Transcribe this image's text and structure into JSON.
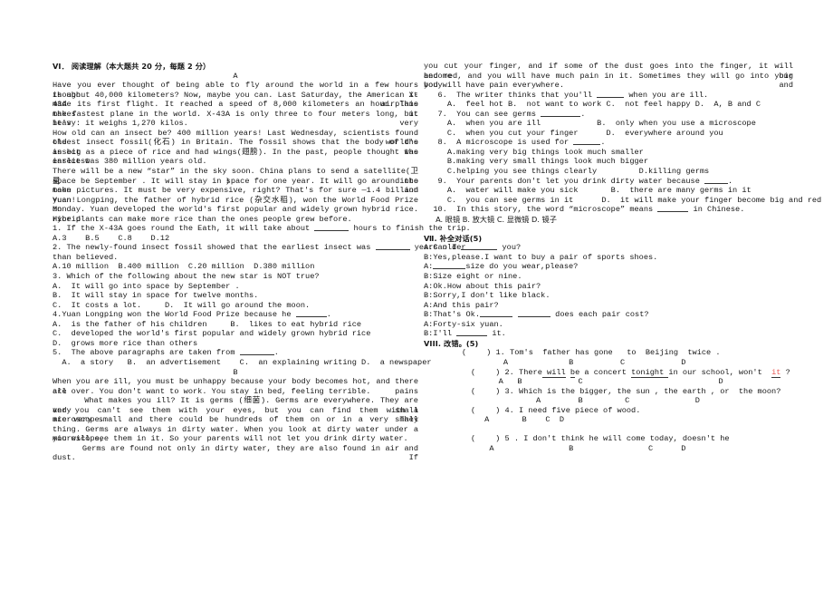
{
  "document": {
    "type": "english-exam-paper",
    "accent_color": "#e8534f",
    "text_color": "#151515"
  },
  "left_column": {
    "section_vi": {
      "heading": "VI． 阅读理解（本大题共 20 分，每题 2 分）",
      "passage_a_label": "A",
      "passage_a": [
        "Have you ever thought of being able to fly around the world in a few hours though it",
        "is about 40,000 kilometers? Now, maybe you can. Last Saturday, the American X-43A airplane",
        "made its first flight. It reached a speed of 8,000 kilometers an hour. This makes it",
        "the fastest plane in the world. X-43A is only three to four meters long, but it's very",
        "heavy: it weighs 1,270 kilos.",
        "How old can an insect be? 400 million years! Last Wednesday, scientists found the world's",
        "oldest insect fossil(化石) in Britain. The fossil shows that the body of the insect was",
        "as big as a piece of rice and had wings(翅膀). In the past, people thought the earliest",
        "insect was 380 million years old.",
        "There will be a new “star” in the sky soon. China plans to send a satellite(卫星) into",
        "space be September . It will stay in space for one year. It will go around the moon and",
        "take pictures. It must be very expensive, right? That's for sure —1.4 billion yuan!",
        "Yuan Longping, the father of hybrid rice (杂交水稻), won the World Food Prize on",
        "Monday. Yuan developed the world's first popular and widely grown hybrid rice. Hybrid",
        "rice plants can make more rice than the ones people grew before."
      ],
      "questions_a": [
        {
          "stem_pre": "1. If the X-43A goes round the Eath, it will take about ",
          "stem_post": " hours to finish the trip.",
          "options_line": "A.3    B.5    C.8    D.12"
        },
        {
          "stem_pre": "2. The newly-found insect fossil showed that the earliest insect was ",
          "stem_post": " years older",
          "stem_cont": "than believed.",
          "options_line": "A.10 million  B.400 million  C.20 million  D.380 million"
        },
        {
          "stem": "3. Which of the following about the new star is NOT true?",
          "option_lines": [
            "A.  It will go into space by September .",
            "B.  It will stay in space for twelve months.",
            "C.  It costs a lot.     D.  It will go around the moon."
          ]
        },
        {
          "stem_pre": "4.Yuan Longping won the World Food Prize because he ",
          "stem_post": ".",
          "option_lines": [
            "A.  is the father of his children     B.  likes to eat hybrid rice",
            "C.  developed the world's first popular and widely grown hybrid rice",
            "D.  grows more rice than others"
          ]
        },
        {
          "stem_pre": "5.  The above paragraphs are taken from ",
          "stem_post": ".",
          "options_line": "  A.  a story   B.  an advertisement    C.  an explaining writing D.  a newspaper"
        }
      ],
      "passage_b_label": "B",
      "passage_b": [
        "When you are ill, you must be unhappy because your body becomes hot, and there are pains",
        "all over. You don't want to work. You stay in bed, feeling terrible.",
        "      What makes you ill? It is germs (细菌). Germs are everywhere. They are very small",
        "and you can't see them with your eyes, but you can find them with a microscope. They",
        "are very small and there could be hundreds of them on or in a very small thing.",
        "      Germs are always in dirty water. When you look at dirty water under a microscope,",
        "you will see them in it. So your parents will not let you drink dirty water.",
        "      Germs are found not only in dirty water, they are also found in air and dust. If"
      ]
    }
  },
  "right_column": {
    "passage_b_continued": [
      "you cut your finger, and if some of the dust goes into the finger, it will become big",
      "and red, and you will have much pain in it. Sometimes they will go into your body and",
      "you will have pain everywhere."
    ],
    "questions_b": [
      {
        "stem_pre": "   6.  The writer thinks that you'll ",
        "stem_post": " when you are ill.",
        "option_lines": [
          "     A.  feel hot B.  not want to work C.  not feel happy D.  A, B and C"
        ]
      },
      {
        "stem_pre": "   7.  You can see germs ",
        "stem_post": ".",
        "option_lines": [
          "     A.  when you are ill            B.  only when you use a microscope",
          "     C.  when you cut your finger      D.  everywhere around you"
        ]
      },
      {
        "stem_pre": "   8.  A microscope is used for ",
        "stem_post": ".",
        "option_lines": [
          "     A.making very big things look much smaller",
          "     B.making very small things look much bigger",
          "     C.helping you see things clearly         D.killing germs"
        ]
      },
      {
        "stem_pre": "   9.  Your parents don't let you drink dirty water because ",
        "stem_post": ".",
        "option_lines": [
          "     A.  water will make you sick       B.  there are many germs in it",
          "     C.  you can see germs in it      D.  it will make your finger become big and red"
        ]
      },
      {
        "stem_pre": "  10.  In this story, the word “microscope” means ",
        "stem_post": " in Chinese.",
        "option_lines": [
          "     A. 眼镜 B. 放大镜 C. 显微镜 D. 镜子"
        ]
      }
    ],
    "section_vii": {
      "heading": "Ⅶ. 补全对话(5)",
      "dialogue": [
        {
          "pre": "A:Can I ",
          "post": " you?"
        },
        {
          "pre": "B:Yes,please.I want to buy a pair of sports shoes.",
          "post": ""
        },
        {
          "pre": "A:",
          "post": "size do you wear,please?"
        },
        {
          "pre": "B:Size eight or nine.",
          "post": ""
        },
        {
          "pre": "A:Ok.How about this pair?",
          "post": ""
        },
        {
          "pre": "B:Sorry,I don't like black.",
          "post": ""
        },
        {
          "pre": "A:And this pair?",
          "post": ""
        },
        {
          "pre": "B:That's Ok.",
          "post": " does each pair cost?"
        },
        {
          "pre": "A:Forty-six yuan.",
          "post": ""
        },
        {
          "pre": "B:I'll ",
          "post": " it."
        }
      ]
    },
    "section_viii": {
      "heading": "VIII. 改错。(5)",
      "items": [
        {
          "number": "1.",
          "text": "Tom's  father has gone   to  Beijing  twice .",
          "markers": "                 A             B          C            D"
        },
        {
          "number": "2.",
          "text": "There will be a concert tonight in our school, won't  it ?",
          "markers": "                A   B            C                             D",
          "red_word": "it"
        },
        {
          "number": "3.",
          "text": "Which is the bigger, the sun , the earth , or  the moon?",
          "markers": "                        A        B         C              D"
        },
        {
          "number": "4.",
          "text": "I need five piece of wood.",
          "markers": "             A       B    C  D"
        },
        {
          "number": "5 .",
          "text": "I don't think he will come today, doesn't he",
          "markers": "              A                B                C      D"
        }
      ]
    }
  }
}
